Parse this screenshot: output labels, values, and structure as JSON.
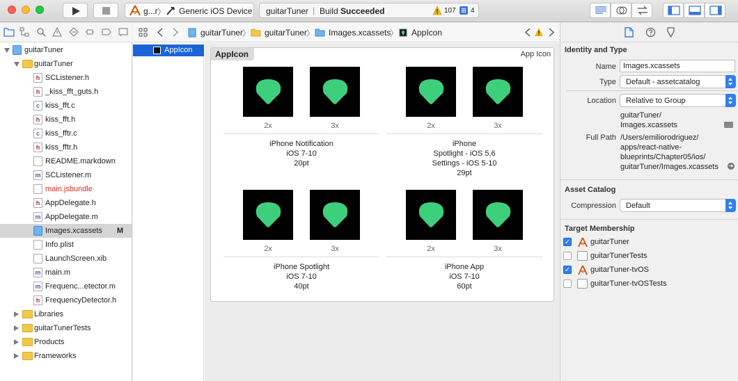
{
  "toolbar": {
    "scheme_name": "g...r",
    "scheme_separator": "〉",
    "destination": "Generic iOS Device",
    "status_project": "guitarTuner",
    "status_pipe": "|",
    "status_build_prefix": "Build",
    "status_build_result": "Succeeded",
    "warning_count": "107",
    "issue_count": "4"
  },
  "navigator": {
    "items": [
      {
        "label": "guitarTuner",
        "indent": 0,
        "kind": "project",
        "disclosure": "open"
      },
      {
        "label": "guitarTuner",
        "indent": 1,
        "kind": "folder",
        "disclosure": "open"
      },
      {
        "label": "SCListener.h",
        "indent": 2,
        "kind": "h"
      },
      {
        "label": "_kiss_fft_guts.h",
        "indent": 2,
        "kind": "h"
      },
      {
        "label": "kiss_fft.c",
        "indent": 2,
        "kind": "c"
      },
      {
        "label": "kiss_fft.h",
        "indent": 2,
        "kind": "h"
      },
      {
        "label": "kiss_fftr.c",
        "indent": 2,
        "kind": "c"
      },
      {
        "label": "kiss_fftr.h",
        "indent": 2,
        "kind": "h"
      },
      {
        "label": "README.markdown",
        "indent": 2,
        "kind": "txt"
      },
      {
        "label": "SCListener.m",
        "indent": 2,
        "kind": "m"
      },
      {
        "label": "main.jsbundle",
        "indent": 2,
        "kind": "txt",
        "missing": true
      },
      {
        "label": "AppDelegate.h",
        "indent": 2,
        "kind": "h"
      },
      {
        "label": "AppDelegate.m",
        "indent": 2,
        "kind": "m"
      },
      {
        "label": "Images.xcassets",
        "indent": 2,
        "kind": "asset",
        "selected": true,
        "badge": "M"
      },
      {
        "label": "Info.plist",
        "indent": 2,
        "kind": "txt"
      },
      {
        "label": "LaunchScreen.xib",
        "indent": 2,
        "kind": "txt"
      },
      {
        "label": "main.m",
        "indent": 2,
        "kind": "m"
      },
      {
        "label": "Frequenc...etector.m",
        "indent": 2,
        "kind": "m"
      },
      {
        "label": "FrequencyDetector.h",
        "indent": 2,
        "kind": "h"
      },
      {
        "label": "Libraries",
        "indent": 1,
        "kind": "folder",
        "disclosure": "closed"
      },
      {
        "label": "guitarTunerTests",
        "indent": 1,
        "kind": "folder",
        "disclosure": "closed"
      },
      {
        "label": "Products",
        "indent": 1,
        "kind": "folder",
        "disclosure": "closed"
      },
      {
        "label": "Frameworks",
        "indent": 1,
        "kind": "folder",
        "disclosure": "closed"
      }
    ]
  },
  "jumpbar": {
    "crumbs": [
      "guitarTuner",
      "guitarTuner",
      "Images.xcassets",
      "AppIcon"
    ],
    "separator": "〉"
  },
  "asset_list": {
    "selected": "AppIcon"
  },
  "icon_set": {
    "title": "AppIcon",
    "type_label": "App Icon",
    "groups": [
      {
        "scales": [
          "2x",
          "3x"
        ],
        "caption": [
          "iPhone Notification",
          "iOS 7-10",
          "20pt"
        ]
      },
      {
        "scales": [
          "2x",
          "3x"
        ],
        "caption": [
          "iPhone",
          "Spotlight - iOS 5,6",
          "Settings - iOS 5-10",
          "29pt"
        ]
      },
      {
        "scales": [
          "2x",
          "3x"
        ],
        "caption": [
          "iPhone Spotlight",
          "iOS 7-10",
          "40pt"
        ]
      },
      {
        "scales": [
          "2x",
          "3x"
        ],
        "caption": [
          "iPhone App",
          "iOS 7-10",
          "60pt"
        ]
      }
    ]
  },
  "inspector": {
    "identity_header": "Identity and Type",
    "name_label": "Name",
    "name_value": "Images.xcassets",
    "type_label": "Type",
    "type_value": "Default - assetcatalog",
    "location_label": "Location",
    "location_value": "Relative to Group",
    "relative_path": [
      "guitarTuner/",
      "Images.xcassets"
    ],
    "full_path_label": "Full Path",
    "full_path": [
      "/Users/emiliorodriguez/",
      "apps/react-native-",
      "blueprints/Chapter05/ios/",
      "guitarTuner/Images.xcassets"
    ],
    "asset_catalog_header": "Asset Catalog",
    "compression_label": "Compression",
    "compression_value": "Default",
    "membership_header": "Target Membership",
    "targets": [
      {
        "label": "guitarTuner",
        "checked": true,
        "kind": "app"
      },
      {
        "label": "guitarTunerTests",
        "checked": false,
        "kind": "test"
      },
      {
        "label": "guitarTuner-tvOS",
        "checked": true,
        "kind": "app"
      },
      {
        "label": "guitarTuner-tvOSTests",
        "checked": false,
        "kind": "test"
      }
    ]
  },
  "colors": {
    "selection_blue": "#1b64d8",
    "icon_green": "#3ecf7d",
    "missing_file_red": "#e0281e"
  }
}
